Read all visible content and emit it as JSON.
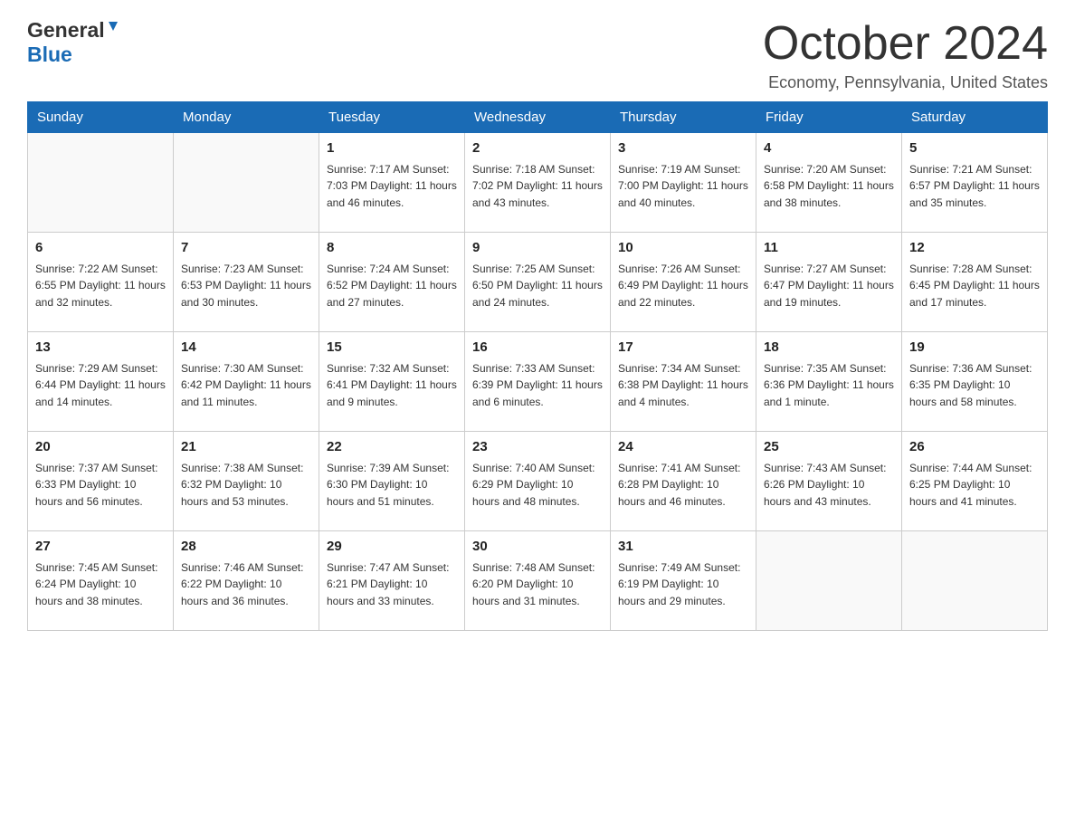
{
  "header": {
    "title": "October 2024",
    "location": "Economy, Pennsylvania, United States",
    "logo_general": "General",
    "logo_blue": "Blue"
  },
  "days_of_week": [
    "Sunday",
    "Monday",
    "Tuesday",
    "Wednesday",
    "Thursday",
    "Friday",
    "Saturday"
  ],
  "weeks": [
    [
      {
        "day": "",
        "info": ""
      },
      {
        "day": "",
        "info": ""
      },
      {
        "day": "1",
        "info": "Sunrise: 7:17 AM\nSunset: 7:03 PM\nDaylight: 11 hours\nand 46 minutes."
      },
      {
        "day": "2",
        "info": "Sunrise: 7:18 AM\nSunset: 7:02 PM\nDaylight: 11 hours\nand 43 minutes."
      },
      {
        "day": "3",
        "info": "Sunrise: 7:19 AM\nSunset: 7:00 PM\nDaylight: 11 hours\nand 40 minutes."
      },
      {
        "day": "4",
        "info": "Sunrise: 7:20 AM\nSunset: 6:58 PM\nDaylight: 11 hours\nand 38 minutes."
      },
      {
        "day": "5",
        "info": "Sunrise: 7:21 AM\nSunset: 6:57 PM\nDaylight: 11 hours\nand 35 minutes."
      }
    ],
    [
      {
        "day": "6",
        "info": "Sunrise: 7:22 AM\nSunset: 6:55 PM\nDaylight: 11 hours\nand 32 minutes."
      },
      {
        "day": "7",
        "info": "Sunrise: 7:23 AM\nSunset: 6:53 PM\nDaylight: 11 hours\nand 30 minutes."
      },
      {
        "day": "8",
        "info": "Sunrise: 7:24 AM\nSunset: 6:52 PM\nDaylight: 11 hours\nand 27 minutes."
      },
      {
        "day": "9",
        "info": "Sunrise: 7:25 AM\nSunset: 6:50 PM\nDaylight: 11 hours\nand 24 minutes."
      },
      {
        "day": "10",
        "info": "Sunrise: 7:26 AM\nSunset: 6:49 PM\nDaylight: 11 hours\nand 22 minutes."
      },
      {
        "day": "11",
        "info": "Sunrise: 7:27 AM\nSunset: 6:47 PM\nDaylight: 11 hours\nand 19 minutes."
      },
      {
        "day": "12",
        "info": "Sunrise: 7:28 AM\nSunset: 6:45 PM\nDaylight: 11 hours\nand 17 minutes."
      }
    ],
    [
      {
        "day": "13",
        "info": "Sunrise: 7:29 AM\nSunset: 6:44 PM\nDaylight: 11 hours\nand 14 minutes."
      },
      {
        "day": "14",
        "info": "Sunrise: 7:30 AM\nSunset: 6:42 PM\nDaylight: 11 hours\nand 11 minutes."
      },
      {
        "day": "15",
        "info": "Sunrise: 7:32 AM\nSunset: 6:41 PM\nDaylight: 11 hours\nand 9 minutes."
      },
      {
        "day": "16",
        "info": "Sunrise: 7:33 AM\nSunset: 6:39 PM\nDaylight: 11 hours\nand 6 minutes."
      },
      {
        "day": "17",
        "info": "Sunrise: 7:34 AM\nSunset: 6:38 PM\nDaylight: 11 hours\nand 4 minutes."
      },
      {
        "day": "18",
        "info": "Sunrise: 7:35 AM\nSunset: 6:36 PM\nDaylight: 11 hours\nand 1 minute."
      },
      {
        "day": "19",
        "info": "Sunrise: 7:36 AM\nSunset: 6:35 PM\nDaylight: 10 hours\nand 58 minutes."
      }
    ],
    [
      {
        "day": "20",
        "info": "Sunrise: 7:37 AM\nSunset: 6:33 PM\nDaylight: 10 hours\nand 56 minutes."
      },
      {
        "day": "21",
        "info": "Sunrise: 7:38 AM\nSunset: 6:32 PM\nDaylight: 10 hours\nand 53 minutes."
      },
      {
        "day": "22",
        "info": "Sunrise: 7:39 AM\nSunset: 6:30 PM\nDaylight: 10 hours\nand 51 minutes."
      },
      {
        "day": "23",
        "info": "Sunrise: 7:40 AM\nSunset: 6:29 PM\nDaylight: 10 hours\nand 48 minutes."
      },
      {
        "day": "24",
        "info": "Sunrise: 7:41 AM\nSunset: 6:28 PM\nDaylight: 10 hours\nand 46 minutes."
      },
      {
        "day": "25",
        "info": "Sunrise: 7:43 AM\nSunset: 6:26 PM\nDaylight: 10 hours\nand 43 minutes."
      },
      {
        "day": "26",
        "info": "Sunrise: 7:44 AM\nSunset: 6:25 PM\nDaylight: 10 hours\nand 41 minutes."
      }
    ],
    [
      {
        "day": "27",
        "info": "Sunrise: 7:45 AM\nSunset: 6:24 PM\nDaylight: 10 hours\nand 38 minutes."
      },
      {
        "day": "28",
        "info": "Sunrise: 7:46 AM\nSunset: 6:22 PM\nDaylight: 10 hours\nand 36 minutes."
      },
      {
        "day": "29",
        "info": "Sunrise: 7:47 AM\nSunset: 6:21 PM\nDaylight: 10 hours\nand 33 minutes."
      },
      {
        "day": "30",
        "info": "Sunrise: 7:48 AM\nSunset: 6:20 PM\nDaylight: 10 hours\nand 31 minutes."
      },
      {
        "day": "31",
        "info": "Sunrise: 7:49 AM\nSunset: 6:19 PM\nDaylight: 10 hours\nand 29 minutes."
      },
      {
        "day": "",
        "info": ""
      },
      {
        "day": "",
        "info": ""
      }
    ]
  ]
}
